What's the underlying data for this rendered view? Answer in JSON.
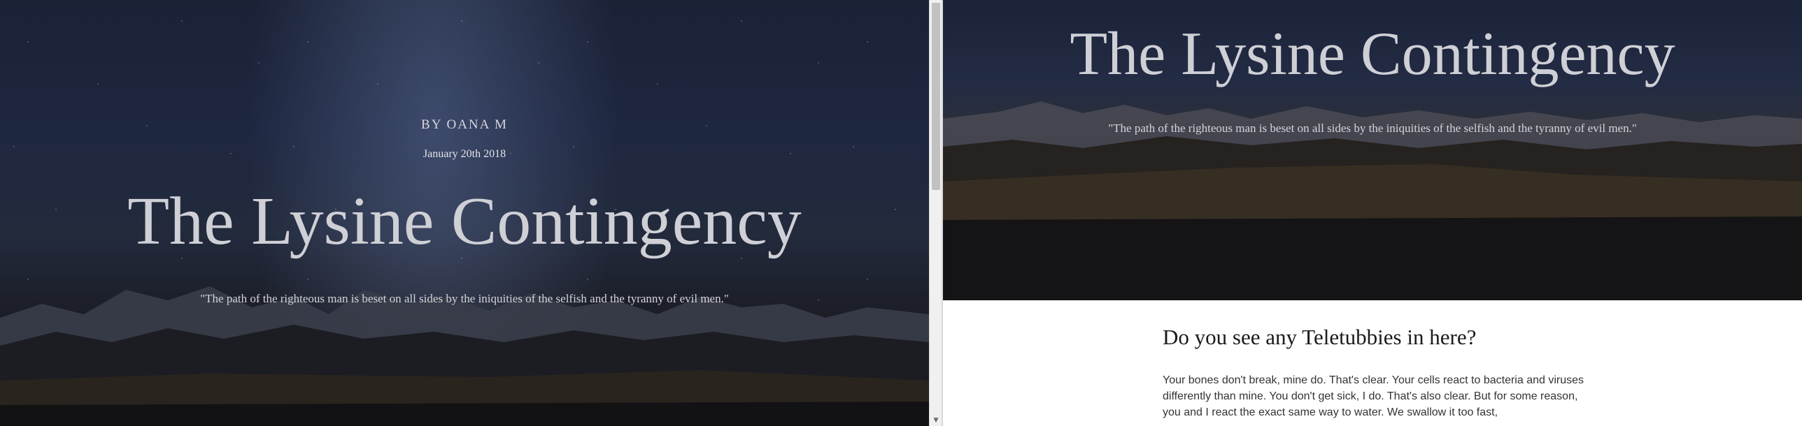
{
  "left": {
    "byline": "BY OANA M",
    "date": "January 20th 2018",
    "title": "The Lysine Contingency",
    "quote": "\"The path of the righteous man is beset on all sides by the iniquities of the selfish and the tyranny of evil men.\""
  },
  "right": {
    "title": "The Lysine Contingency",
    "quote": "\"The path of the righteous man is beset on all sides by the iniquities of the selfish and the tyranny of evil men.\"",
    "heading": "Do you see any Teletubbies in here?",
    "body": "Your bones don't break, mine do. That's clear. Your cells react to bacteria and viruses differently than mine. You don't get sick, I do. That's also clear. But for some reason, you and I react the exact same way to water. We swallow it too fast,"
  },
  "scrollbar": {
    "arrow_icon": "scroll-down-arrow-icon"
  }
}
